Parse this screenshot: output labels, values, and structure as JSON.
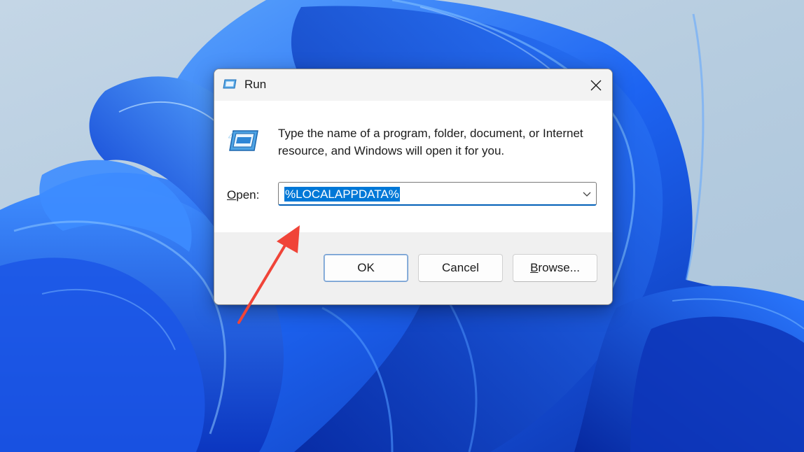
{
  "dialog": {
    "title": "Run",
    "description": "Type the name of a program, folder, document, or Internet resource, and Windows will open it for you.",
    "open_label_accel": "O",
    "open_label_rest": "pen:",
    "open_value": "%LOCALAPPDATA%",
    "buttons": {
      "ok": "OK",
      "cancel": "Cancel",
      "browse_accel": "B",
      "browse_rest": "rowse..."
    }
  },
  "icons": {
    "title": "run-app-icon",
    "main": "run-app-icon",
    "close": "close-icon",
    "dropdown": "chevron-down-icon",
    "annotation": "red-arrow-annotation"
  },
  "colors": {
    "selection": "#0078d7",
    "focus_border": "#005fb8",
    "annotation": "#f04438",
    "wallpaper_blue": "#1a5cf0"
  }
}
